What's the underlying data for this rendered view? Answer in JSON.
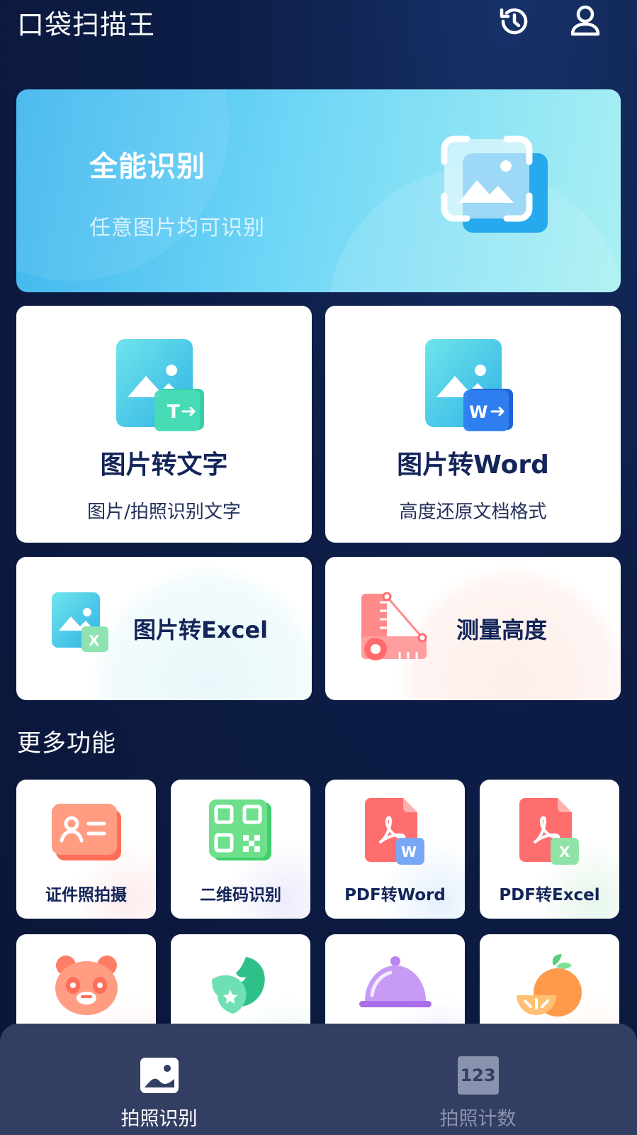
{
  "header": {
    "title": "口袋扫描王",
    "history_icon": "history-icon",
    "profile_icon": "user-icon"
  },
  "banner": {
    "title": "全能识别",
    "subtitle": "任意图片均可识别",
    "icon": "image-scan-icon"
  },
  "main_features": [
    {
      "title": "图片转文字",
      "subtitle": "图片/拍照识别文字",
      "icon": "image-to-text-icon"
    },
    {
      "title": "图片转Word",
      "subtitle": "高度还原文档格式",
      "icon": "image-to-word-icon"
    },
    {
      "title": "图片转Excel",
      "icon": "image-to-excel-icon"
    },
    {
      "title": "测量高度",
      "icon": "measure-height-icon"
    }
  ],
  "more": {
    "title": "更多功能",
    "items": [
      {
        "label": "证件照拍摄",
        "icon": "id-card-icon"
      },
      {
        "label": "二维码识别",
        "icon": "qr-code-icon"
      },
      {
        "label": "PDF转Word",
        "icon": "pdf-word-icon"
      },
      {
        "label": "PDF转Excel",
        "icon": "pdf-excel-icon"
      },
      {
        "label": "",
        "icon": "panda-icon"
      },
      {
        "label": "",
        "icon": "plant-icon"
      },
      {
        "label": "",
        "icon": "food-cloche-icon"
      },
      {
        "label": "",
        "icon": "fruit-icon"
      }
    ]
  },
  "tabbar": {
    "tabs": [
      {
        "label": "拍照识别",
        "icon": "photo-icon",
        "active": true
      },
      {
        "label": "拍照计数",
        "icon": "counter-123-icon",
        "active": false
      }
    ],
    "counter_glyph": "123"
  },
  "colors": {
    "background": "#0d1d46",
    "card_title": "#132559",
    "tabbar": "#333e63",
    "tab_active": "#ffffff",
    "tab_inactive": "#8a93ad"
  }
}
